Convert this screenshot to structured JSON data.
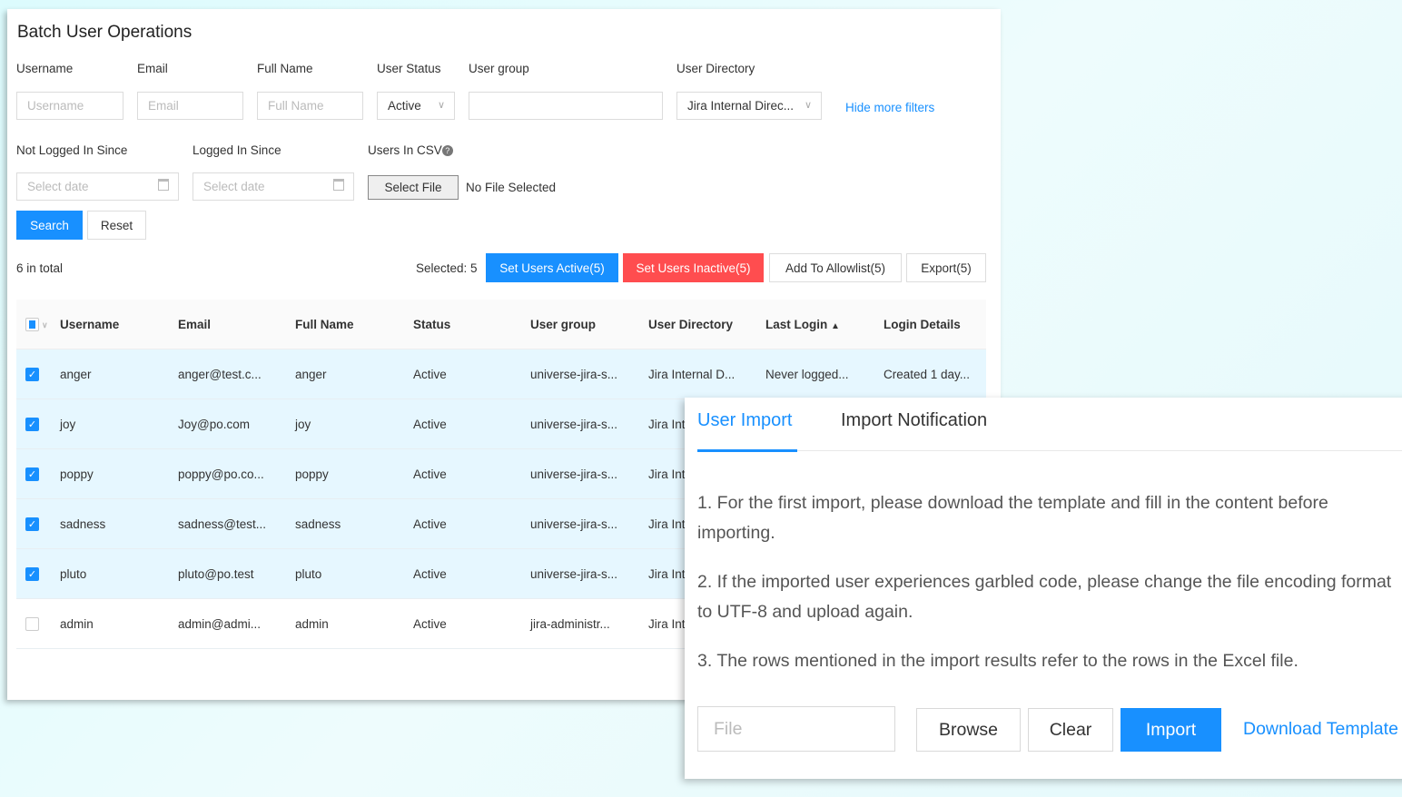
{
  "title": "Batch User Operations",
  "filters": {
    "username_label": "Username",
    "username_ph": "Username",
    "email_label": "Email",
    "email_ph": "Email",
    "fullname_label": "Full Name",
    "fullname_ph": "Full Name",
    "status_label": "User Status",
    "status_value": "Active",
    "group_label": "User group",
    "group_value": "",
    "dir_label": "User Directory",
    "dir_value": "Jira Internal Direc...",
    "hide_filters": "Hide more filters",
    "not_logged_label": "Not Logged In Since",
    "not_logged_ph": "Select date",
    "logged_label": "Logged In Since",
    "logged_ph": "Select date",
    "csv_label": "Users In CSV",
    "select_file": "Select File",
    "no_file": "No File Selected",
    "search": "Search",
    "reset": "Reset"
  },
  "toolbar": {
    "total": "6 in total",
    "selected": "Selected: 5",
    "set_active": "Set Users Active(5)",
    "set_inactive": "Set Users Inactive(5)",
    "allowlist": "Add To Allowlist(5)",
    "export": "Export(5)"
  },
  "table": {
    "headers": [
      "Username",
      "Email",
      "Full Name",
      "Status",
      "User group",
      "User Directory",
      "Last Login",
      "Login Details"
    ],
    "rows": [
      {
        "checked": true,
        "cells": [
          "anger",
          "anger@test.c...",
          "anger",
          "Active",
          "universe-jira-s...",
          "Jira Internal D...",
          "Never logged...",
          "Created 1 day..."
        ]
      },
      {
        "checked": true,
        "cells": [
          "joy",
          "Joy@po.com",
          "joy",
          "Active",
          "universe-jira-s...",
          "Jira Int",
          "",
          ""
        ]
      },
      {
        "checked": true,
        "cells": [
          "poppy",
          "poppy@po.co...",
          "poppy",
          "Active",
          "universe-jira-s...",
          "Jira Int",
          "",
          ""
        ]
      },
      {
        "checked": true,
        "cells": [
          "sadness",
          "sadness@test...",
          "sadness",
          "Active",
          "universe-jira-s...",
          "Jira Int",
          "",
          ""
        ]
      },
      {
        "checked": true,
        "cells": [
          "pluto",
          "pluto@po.test",
          "pluto",
          "Active",
          "universe-jira-s...",
          "Jira Int",
          "",
          ""
        ]
      },
      {
        "checked": false,
        "cells": [
          "admin",
          "admin@admi...",
          "admin",
          "Active",
          "jira-administr...",
          "Jira Int",
          "",
          ""
        ]
      }
    ]
  },
  "modal": {
    "tabs": [
      "User Import",
      "Import Notification"
    ],
    "p1": "1. For the first import, please download the template and fill in the content before importing.",
    "p2": "2. If the imported user experiences garbled code, please change the file encoding format to UTF-8 and upload again.",
    "p3": "3. The rows mentioned in the import results refer to the rows in the Excel file.",
    "file_ph": "File",
    "browse": "Browse",
    "clear": "Clear",
    "import": "Import",
    "download": "Download Template"
  }
}
